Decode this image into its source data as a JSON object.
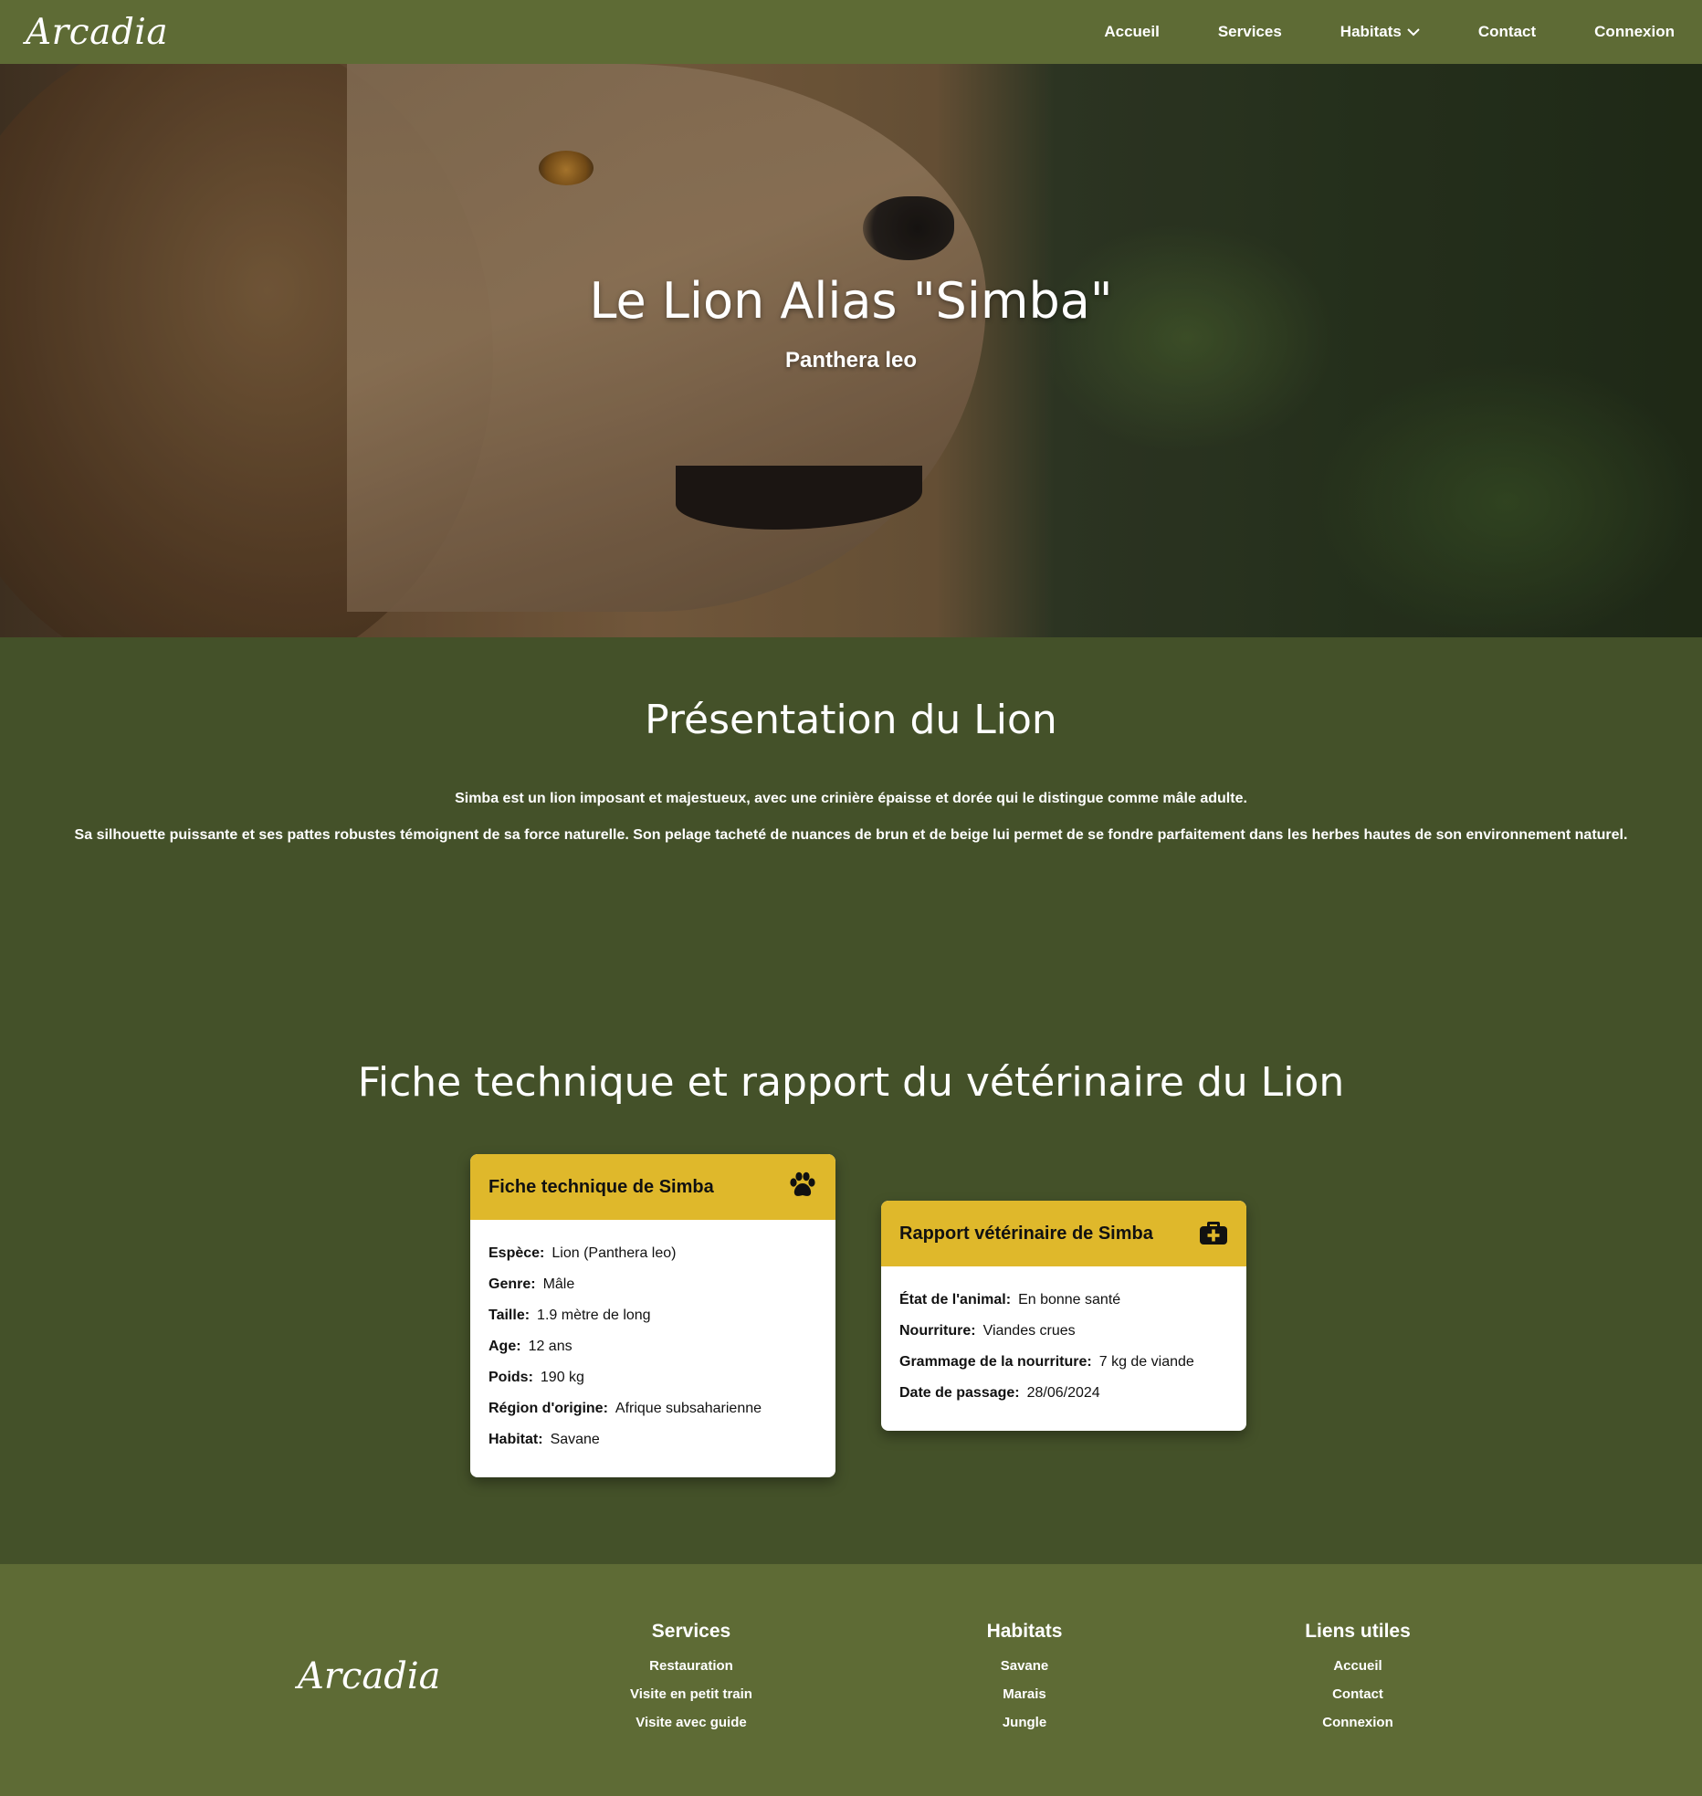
{
  "navbar": {
    "brand": "Arcadia",
    "links": [
      "Accueil",
      "Services",
      "Habitats",
      "Contact",
      "Connexion"
    ]
  },
  "hero": {
    "title": "Le Lion Alias \"Simba\"",
    "subtitle": "Panthera leo"
  },
  "presentation": {
    "title": "Présentation du Lion",
    "paragraph1": "Simba est un lion imposant et majestueux, avec une crinière épaisse et dorée qui le distingue comme mâle adulte.",
    "paragraph2": "Sa silhouette puissante et ses pattes robustes témoignent de sa force naturelle. Son pelage tacheté de nuances de brun et de beige lui permet de se fondre parfaitement dans les herbes hautes de son environnement naturel."
  },
  "fiche_section": {
    "title": "Fiche technique et rapport du vétérinaire du Lion"
  },
  "fiche": {
    "title": "Fiche technique de Simba",
    "icon": "paw-icon",
    "fields": [
      {
        "label": "Espèce:",
        "value": "Lion (Panthera leo)"
      },
      {
        "label": "Genre:",
        "value": "Mâle"
      },
      {
        "label": "Taille:",
        "value": "1.9 mètre de long"
      },
      {
        "label": "Age:",
        "value": "12 ans"
      },
      {
        "label": "Poids:",
        "value": "190 kg"
      },
      {
        "label": "Région d'origine:",
        "value": "Afrique subsaharienne"
      },
      {
        "label": "Habitat:",
        "value": "Savane"
      }
    ]
  },
  "rapport": {
    "title": "Rapport vétérinaire de Simba",
    "icon": "medical-kit-icon",
    "fields": [
      {
        "label": "État de l'animal:",
        "value": "En bonne santé"
      },
      {
        "label": "Nourriture:",
        "value": "Viandes crues"
      },
      {
        "label": "Grammage de la nourriture:",
        "value": "7 kg de viande"
      },
      {
        "label": "Date de passage:",
        "value": "28/06/2024"
      }
    ]
  },
  "footer": {
    "brand": "Arcadia",
    "services": {
      "title": "Services",
      "links": [
        "Restauration",
        "Visite en petit train",
        "Visite avec guide"
      ]
    },
    "habitats": {
      "title": "Habitats",
      "links": [
        "Savane",
        "Marais",
        "Jungle"
      ]
    },
    "liens": {
      "title": "Liens utiles",
      "links": [
        "Accueil",
        "Contact",
        "Connexion"
      ]
    }
  },
  "colors": {
    "navbar": "#5e6b35",
    "background": "#445129",
    "card_header": "#dfb82b",
    "footer": "#5e6b35"
  }
}
